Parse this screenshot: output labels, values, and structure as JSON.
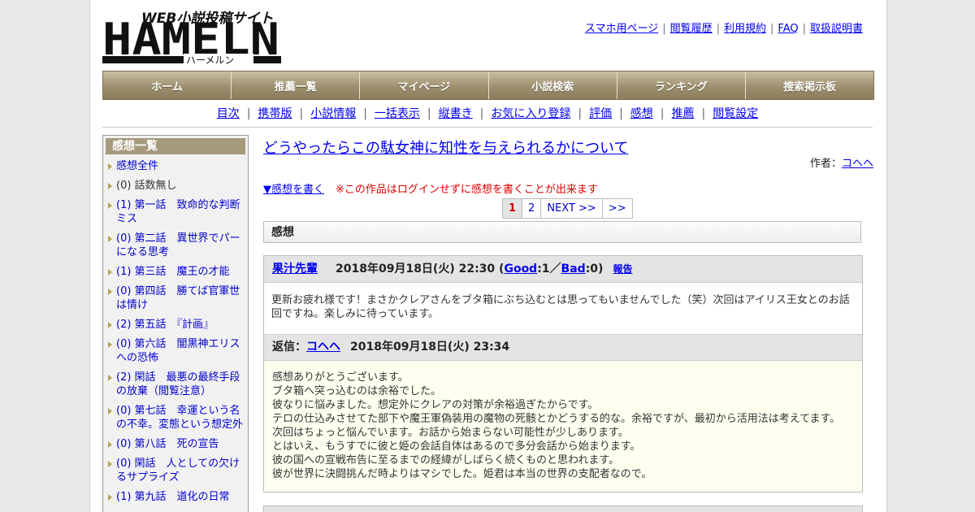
{
  "header": {
    "logo_tagline": "WEB小説投稿サイト",
    "logo_main": "HAMELN",
    "logo_kana": "ハーメルン",
    "top_links": [
      "スマホ用ページ",
      "閲覧履歴",
      "利用規約",
      "FAQ",
      "取扱説明書"
    ]
  },
  "main_nav": [
    "ホーム",
    "推薦一覧",
    "マイページ",
    "小説検索",
    "ランキング",
    "捜索掲示板"
  ],
  "sub_nav": [
    "目次",
    "携帯版",
    "小説情報",
    "一括表示",
    "縦書き",
    "お気に入り登録",
    "評価",
    "感想",
    "推薦",
    "閲覧設定"
  ],
  "sidebar": {
    "title": "感想一覧",
    "items": [
      {
        "text": "感想全件",
        "link": true
      },
      {
        "text": "(0) 話数無し",
        "link": false
      },
      {
        "text": "(1) 第一話　致命的な判断ミス",
        "link": true
      },
      {
        "text": "(0) 第二話　異世界でパーになる思考",
        "link": true
      },
      {
        "text": "(1) 第三話　魔王の才能",
        "link": true
      },
      {
        "text": "(0) 第四話　勝てば官軍世は情け",
        "link": true
      },
      {
        "text": "(2) 第五話　『計画』",
        "link": true
      },
      {
        "text": "(0) 第六話　闇黒神エリスへの恐怖",
        "link": true
      },
      {
        "text": "(2) 閑話　最悪の最終手段の放棄（閲覧注意）",
        "link": true
      },
      {
        "text": "(0) 第七話　幸運という名の不幸。変態という想定外",
        "link": true
      },
      {
        "text": "(0) 第八話　死の宣告",
        "link": true
      },
      {
        "text": "(0) 閑話　人としての欠けるサプライズ",
        "link": true
      },
      {
        "text": "(1) 第九話　道化の日常",
        "link": true
      }
    ]
  },
  "novel": {
    "title": "どうやったらこの駄女神に知性を与えられるかについて",
    "author_label": "作者：",
    "author_name": "コヘヘ"
  },
  "write": {
    "link": "▼感想を書く",
    "note": "※この作品はログインせずに感想を書くことが出来ます"
  },
  "pager": [
    "1",
    "2",
    "NEXT >>",
    ">>"
  ],
  "section_title": "感想",
  "comment": {
    "author": "果汁先輩",
    "date": "2018年09月18日(火) 22:30",
    "good_label": "Good",
    "good_count": ":1／",
    "bad_label": "Bad",
    "bad_count": ":0)",
    "paren_open": " (",
    "report": "報告",
    "body": "更新お疲れ様です！まさかクレアさんをブタ箱にぶち込むとは思ってもいませんでした（笑）次回はアイリス王女とのお話回ですね。楽しみに待っています。"
  },
  "reply": {
    "label": "返信：",
    "author": "コヘヘ",
    "date": "2018年09月18日(火) 23:34",
    "lines": [
      "感想ありがとうございます。",
      "ブタ箱へ突っ込むのは余裕でした。",
      "彼なりに悩みました。想定外にクレアの対策が余裕過ぎたからです。",
      "テロの仕込みさせてた部下や魔王軍偽装用の魔物の死骸とかどうする的な。余裕ですが、最初から活用法は考えてます。",
      "次回はちょっと悩んでいます。お話から始まらない可能性が少しあります。",
      "とはいえ、もうすでに彼と姫の会話自体はあるので多分会話から始まります。",
      "彼の国への宣戦布告に至るまでの経緯がしばらく続くものと思われます。",
      "彼が世界に決闘挑んだ時よりはマシでした。姫君は本当の世界の支配者なので。"
    ]
  },
  "colors": {
    "nav_bg": "#9d8f6e",
    "sidebar_head": "#a69a7d",
    "link": "#0000ee",
    "note_red": "#e00000",
    "reply_bg": "#fffff0"
  }
}
